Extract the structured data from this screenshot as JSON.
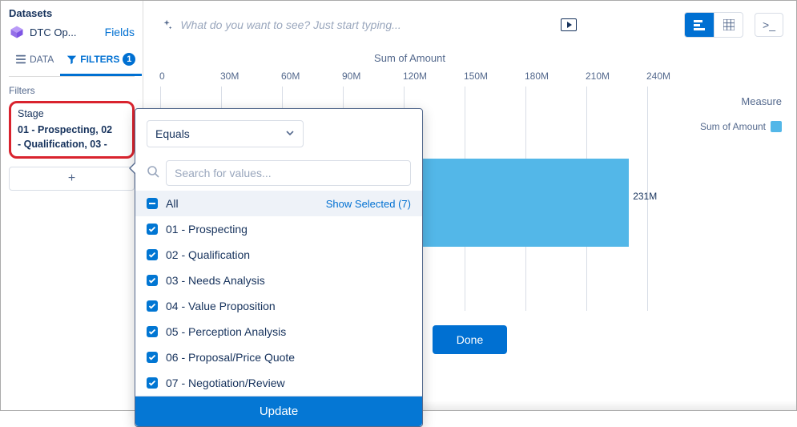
{
  "sidebar": {
    "section_title": "Datasets",
    "dataset_name": "DTC Op...",
    "fields_link": "Fields",
    "tabs": {
      "data": "DATA",
      "filters": "FILTERS",
      "filter_count": "1"
    },
    "filters_label": "Filters",
    "filter_card": {
      "name": "Stage",
      "values_line1": "01 - Prospecting, 02",
      "values_line2": "- Qualification, 03 -"
    },
    "add_label": "+"
  },
  "topbar": {
    "search_placeholder": "What do you want to see? Just start typing...",
    "prompt_glyph": ">_"
  },
  "chart_data": {
    "type": "bar",
    "title": "Sum of Amount",
    "xlabel": "",
    "ylabel": "",
    "xlim": [
      0,
      250
    ],
    "tick_labels": [
      "0",
      "30M",
      "60M",
      "90M",
      "120M",
      "150M",
      "180M",
      "210M",
      "240M"
    ],
    "tick_values": [
      0,
      30,
      60,
      90,
      120,
      150,
      180,
      210,
      240
    ],
    "series": [
      {
        "name": "Sum of Amount",
        "values": [
          231
        ],
        "value_labels": [
          "231M"
        ],
        "color": "#53b7e8"
      }
    ],
    "measure_label": "Measure",
    "legend_label": "Sum of Amount"
  },
  "popover": {
    "operator": "Equals",
    "search_placeholder": "Search for values...",
    "all_label": "All",
    "show_selected_label": "Show Selected (7)",
    "options": [
      "01 - Prospecting",
      "02 - Qualification",
      "03 - Needs Analysis",
      "04 - Value Proposition",
      "05 - Perception Analysis",
      "06 - Proposal/Price Quote",
      "07 - Negotiation/Review"
    ],
    "update_label": "Update"
  },
  "footer": {
    "done_label": "Done"
  }
}
